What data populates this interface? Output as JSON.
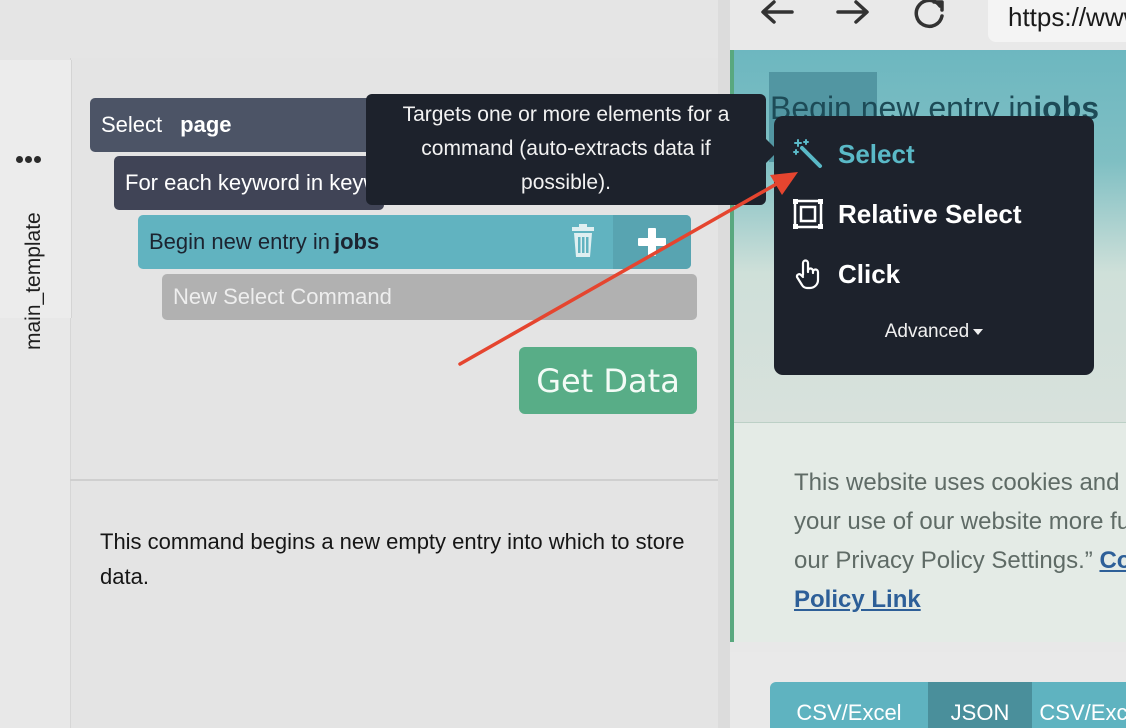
{
  "sidebar": {
    "template_label": "main_template"
  },
  "commands": {
    "select_keyword": "Select",
    "select_target": "page",
    "foreach_text": "For each keyword in keywords",
    "begin_text": "Begin new entry in",
    "begin_target": "jobs",
    "new_select": "New Select Command"
  },
  "get_data_label": "Get Data",
  "description": "This command begins a new empty entry into which to store data.",
  "tooltip": "Targets one or more elements for a command (auto-extracts data if possible).",
  "browser": {
    "url": "https://www"
  },
  "site": {
    "hero_prefix": "Begin new entry in",
    "hero_target": "jobs",
    "cookie_text": "This website uses cookies and analyze your use of our website more fully in our Privacy Policy Settings.”",
    "cookie_link": "Cookie Policy Link"
  },
  "dropdown": {
    "items": [
      {
        "label": "Select",
        "icon": "magic-wand-icon"
      },
      {
        "label": "Relative Select",
        "icon": "relative-select-icon"
      },
      {
        "label": "Click",
        "icon": "pointer-hand-icon"
      }
    ],
    "advanced_label": "Advanced"
  },
  "export_buttons": [
    "CSV/Excel",
    "JSON",
    "CSV/Excel"
  ],
  "colors": {
    "accent_teal": "#61b3c0",
    "get_data_green": "#58ad87",
    "tooltip_dark": "#1d222c",
    "arrow_red": "#e5452f"
  }
}
